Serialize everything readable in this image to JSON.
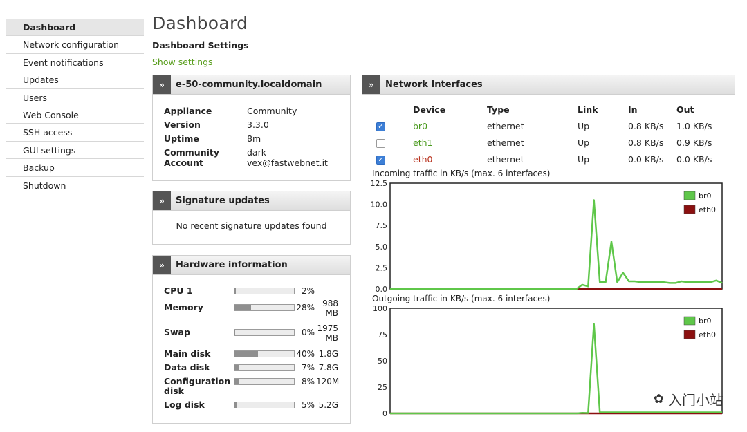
{
  "sidebar": {
    "items": [
      {
        "label": "Dashboard",
        "active": true
      },
      {
        "label": "Network configuration"
      },
      {
        "label": "Event notifications"
      },
      {
        "label": "Updates"
      },
      {
        "label": "Users"
      },
      {
        "label": "Web Console"
      },
      {
        "label": "SSH access"
      },
      {
        "label": "GUI settings"
      },
      {
        "label": "Backup"
      },
      {
        "label": "Shutdown"
      }
    ]
  },
  "header": {
    "title": "Dashboard",
    "settings_title": "Dashboard Settings",
    "show_settings": "Show settings"
  },
  "appliance_panel": {
    "title": "e-50-community.localdomain",
    "rows": [
      {
        "key": "Appliance",
        "value": "Community"
      },
      {
        "key": "Version",
        "value": "3.3.0"
      },
      {
        "key": "Uptime",
        "value": "8m"
      },
      {
        "key": "Community Account",
        "value": "dark-vex@fastwebnet.it"
      }
    ]
  },
  "signature_panel": {
    "title": "Signature updates",
    "message": "No recent signature updates found"
  },
  "hardware_panel": {
    "title": "Hardware information",
    "rows": [
      {
        "label": "CPU 1",
        "percent": 2,
        "pct_text": "2%",
        "size": ""
      },
      {
        "label": "Memory",
        "percent": 28,
        "pct_text": "28%",
        "size": "988 MB"
      },
      {
        "label": "Swap",
        "percent": 0,
        "pct_text": "0%",
        "size": "1975 MB"
      },
      {
        "label": "Main disk",
        "percent": 40,
        "pct_text": "40%",
        "size": "1.8G"
      },
      {
        "label": "Data disk",
        "percent": 7,
        "pct_text": "7%",
        "size": "7.8G"
      },
      {
        "label": "Configuration disk",
        "percent": 8,
        "pct_text": "8%",
        "size": "120M"
      },
      {
        "label": "Log disk",
        "percent": 5,
        "pct_text": "5%",
        "size": "5.2G"
      }
    ]
  },
  "network_panel": {
    "title": "Network Interfaces",
    "columns": [
      "Device",
      "Type",
      "Link",
      "In",
      "Out"
    ],
    "rows": [
      {
        "checked": true,
        "device": "br0",
        "device_color": "#4a9a1e",
        "type": "ethernet",
        "link": "Up",
        "in": "0.8 KB/s",
        "out": "1.0 KB/s"
      },
      {
        "checked": false,
        "device": "eth1",
        "device_color": "#4a9a1e",
        "type": "ethernet",
        "link": "Up",
        "in": "0.8 KB/s",
        "out": "0.9 KB/s"
      },
      {
        "checked": true,
        "device": "eth0",
        "device_color": "#b8321e",
        "type": "ethernet",
        "link": "Up",
        "in": "0.0 KB/s",
        "out": "0.0 KB/s"
      }
    ]
  },
  "colors": {
    "br0": "#5fc74a",
    "eth0": "#8b1010"
  },
  "chart_data": [
    {
      "type": "line",
      "title": "Incoming traffic in KB/s (max. 6 interfaces)",
      "ylim": [
        0,
        12.5
      ],
      "yticks": [
        "12.5",
        "10.0",
        "7.5",
        "5.0",
        "2.5",
        "0.0"
      ],
      "ytick_values": [
        12.5,
        10,
        7.5,
        5,
        2.5,
        0
      ],
      "legend_position": "top-right",
      "series": [
        {
          "name": "br0",
          "color": "#5fc74a",
          "values": [
            0,
            0,
            0,
            0,
            0,
            0,
            0,
            0,
            0,
            0,
            0,
            0,
            0,
            0,
            0,
            0,
            0,
            0,
            0,
            0,
            0,
            0,
            0,
            0,
            0,
            0,
            0,
            0,
            0,
            0,
            0,
            0,
            0,
            0.5,
            0.3,
            10.5,
            0.8,
            0.8,
            5.6,
            0.8,
            1.9,
            0.9,
            0.9,
            0.8,
            0.8,
            0.8,
            0.8,
            0.8,
            0.7,
            0.7,
            0.9,
            0.8,
            0.8,
            0.8,
            0.8,
            0.8,
            1.0,
            0.7
          ]
        },
        {
          "name": "eth0",
          "color": "#8b1010",
          "values": [
            0,
            0,
            0,
            0,
            0,
            0,
            0,
            0,
            0,
            0,
            0,
            0,
            0,
            0,
            0,
            0,
            0,
            0,
            0,
            0,
            0,
            0,
            0,
            0,
            0,
            0,
            0,
            0,
            0,
            0,
            0,
            0,
            0,
            0,
            0,
            0,
            0,
            0,
            0,
            0,
            0,
            0,
            0,
            0,
            0,
            0,
            0,
            0,
            0,
            0,
            0,
            0,
            0,
            0,
            0,
            0,
            0,
            0
          ]
        }
      ]
    },
    {
      "type": "line",
      "title": "Outgoing traffic in KB/s (max. 6 interfaces)",
      "ylim": [
        0,
        100
      ],
      "yticks": [
        "100",
        "75",
        "50",
        "25",
        "0"
      ],
      "ytick_values": [
        100,
        75,
        50,
        25,
        0
      ],
      "legend_position": "top-right",
      "series": [
        {
          "name": "br0",
          "color": "#5fc74a",
          "values": [
            0,
            0,
            0,
            0,
            0,
            0,
            0,
            0,
            0,
            0,
            0,
            0,
            0,
            0,
            0,
            0,
            0,
            0,
            0,
            0,
            0,
            0,
            0,
            0,
            0,
            0,
            0,
            0,
            0,
            0,
            0,
            0,
            0,
            0.5,
            0.3,
            85,
            1,
            1,
            1,
            1,
            1,
            1,
            1,
            1,
            1,
            1,
            1,
            1,
            1,
            1,
            1,
            1,
            1,
            1,
            1,
            1,
            1,
            1
          ]
        },
        {
          "name": "eth0",
          "color": "#8b1010",
          "values": [
            0,
            0,
            0,
            0,
            0,
            0,
            0,
            0,
            0,
            0,
            0,
            0,
            0,
            0,
            0,
            0,
            0,
            0,
            0,
            0,
            0,
            0,
            0,
            0,
            0,
            0,
            0,
            0,
            0,
            0,
            0,
            0,
            0,
            0,
            0,
            0,
            0,
            0,
            0,
            0,
            0,
            0,
            0,
            0,
            0,
            0,
            0,
            0,
            0,
            0,
            0,
            0,
            0,
            0,
            0,
            0,
            0,
            0
          ]
        }
      ]
    }
  ],
  "watermark": {
    "icon": "wechat-icon",
    "text": "入门小站"
  }
}
